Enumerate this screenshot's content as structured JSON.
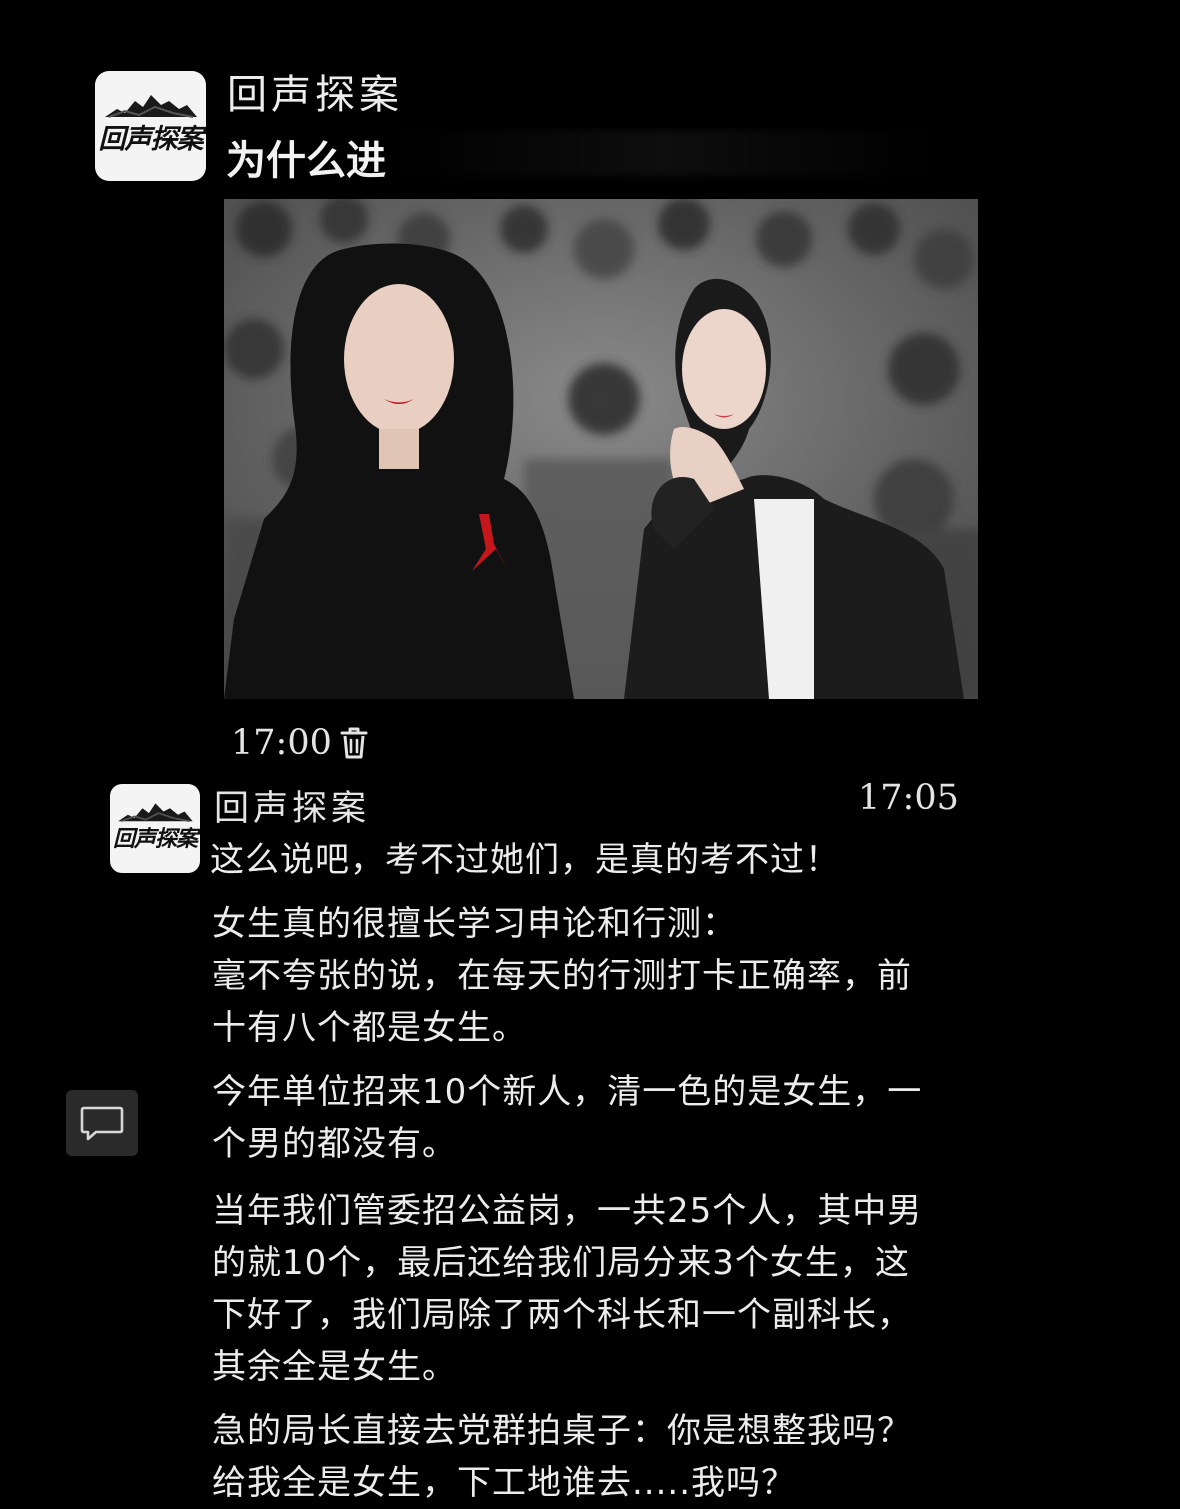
{
  "post": {
    "account_name": "回声探案",
    "title": "为什么进",
    "logo_text": "回声探案",
    "time": "17:00"
  },
  "comment": {
    "account_name": "回声探案",
    "logo_text": "回声探案",
    "time": "17:05",
    "paragraphs": [
      [
        "这么说吧，考不过她们，是真的考不过！"
      ],
      [
        "女生真的很擅长学习申论和行测：",
        "毫不夸张的说，在每天的行测打卡正确率，前",
        "十有八个都是女生。"
      ],
      [
        "今年单位招来10个新人，清一色的是女生，一",
        "个男的都没有。"
      ],
      [
        "当年我们管委招公益岗，一共25个人，其中男",
        "的就10个，最后还给我们局分来3个女生，这",
        "下好了，我们局除了两个科长和一个副科长，",
        "其余全是女生。"
      ],
      [
        "急的局长直接去党群拍桌子：你是想整我吗？",
        "给我全是女生，下工地谁去.....我吗？"
      ]
    ]
  },
  "icons": {
    "trash": "trash-icon",
    "comment": "comment-icon"
  }
}
